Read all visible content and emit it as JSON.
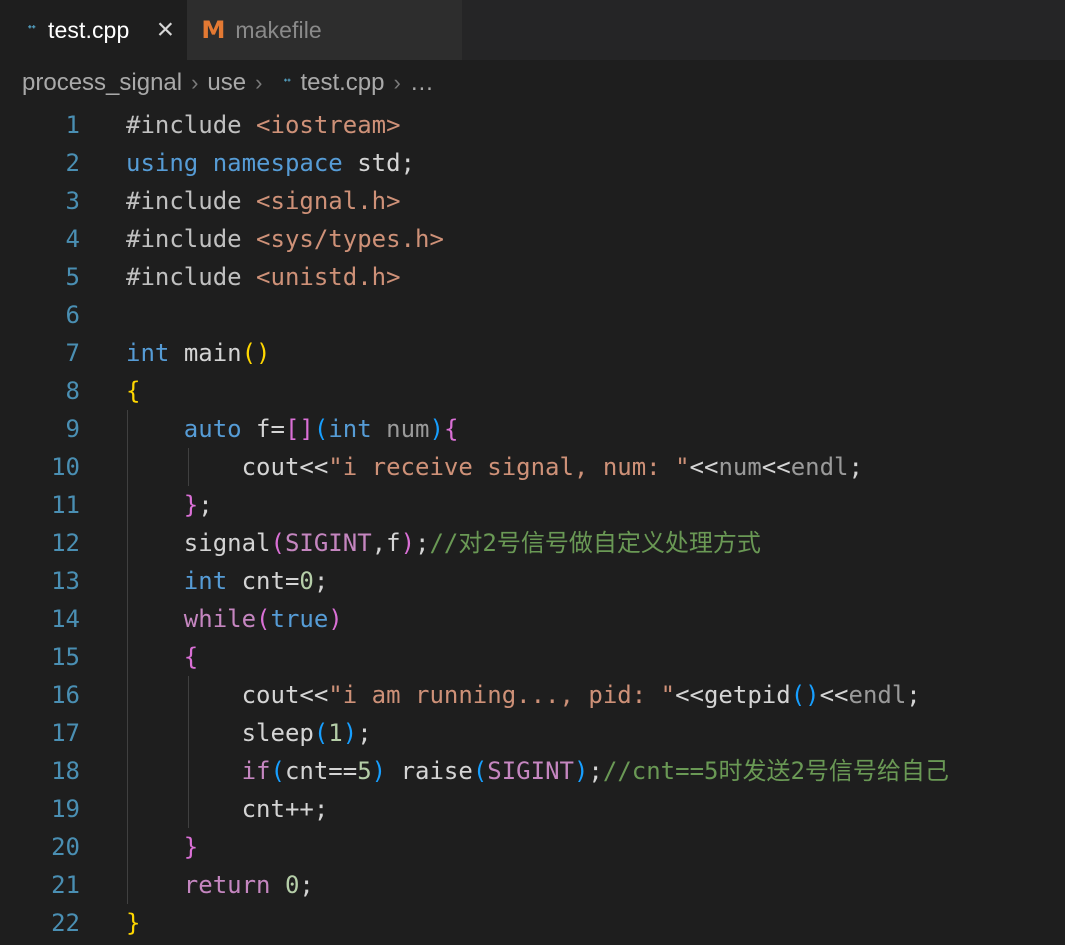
{
  "window": {
    "app": "Visual Studio Code",
    "theme": "Dark+"
  },
  "tabs": [
    {
      "label": "test.cpp",
      "icon": "cpp-file-icon",
      "active": true,
      "close_glyph": "×"
    },
    {
      "label": "makefile",
      "icon": "makefile-icon",
      "active": false,
      "close_glyph": ""
    }
  ],
  "breadcrumb": {
    "separator": "›",
    "items": [
      {
        "label": "process_signal",
        "icon": ""
      },
      {
        "label": "use",
        "icon": ""
      },
      {
        "label": "test.cpp",
        "icon": "cpp-file-icon"
      },
      {
        "label": "…",
        "icon": ""
      }
    ]
  },
  "editor": {
    "language": "C++",
    "first_line": 1,
    "last_line": 22,
    "lines": [
      {
        "n": "1",
        "indent": 0,
        "tokens": [
          {
            "t": "#include ",
            "c": "t-pre"
          },
          {
            "t": "<iostream>",
            "c": "t-inc"
          }
        ]
      },
      {
        "n": "2",
        "indent": 0,
        "tokens": [
          {
            "t": "using namespace",
            "c": "t-kw"
          },
          {
            "t": " std;",
            "c": "t-plain"
          }
        ]
      },
      {
        "n": "3",
        "indent": 0,
        "tokens": [
          {
            "t": "#include ",
            "c": "t-pre"
          },
          {
            "t": "<signal.h>",
            "c": "t-inc"
          }
        ]
      },
      {
        "n": "4",
        "indent": 0,
        "tokens": [
          {
            "t": "#include ",
            "c": "t-pre"
          },
          {
            "t": "<sys/types.h>",
            "c": "t-inc"
          }
        ]
      },
      {
        "n": "5",
        "indent": 0,
        "tokens": [
          {
            "t": "#include ",
            "c": "t-pre"
          },
          {
            "t": "<unistd.h>",
            "c": "t-inc"
          }
        ]
      },
      {
        "n": "6",
        "indent": 0,
        "tokens": []
      },
      {
        "n": "7",
        "indent": 0,
        "tokens": [
          {
            "t": "int",
            "c": "t-kw"
          },
          {
            "t": " ",
            "c": "t-plain"
          },
          {
            "t": "main",
            "c": "t-plain"
          },
          {
            "t": "()",
            "c": "t-b1"
          }
        ]
      },
      {
        "n": "8",
        "indent": 0,
        "tokens": [
          {
            "t": "{",
            "c": "t-b1"
          }
        ]
      },
      {
        "n": "9",
        "indent": 1,
        "tokens": [
          {
            "t": "    ",
            "c": "t-plain"
          },
          {
            "t": "auto",
            "c": "t-kw"
          },
          {
            "t": " f=",
            "c": "t-plain"
          },
          {
            "t": "[]",
            "c": "t-b2"
          },
          {
            "t": "(",
            "c": "t-b3"
          },
          {
            "t": "int",
            "c": "t-kw"
          },
          {
            "t": " ",
            "c": "t-plain"
          },
          {
            "t": "num",
            "c": "t-param"
          },
          {
            "t": ")",
            "c": "t-b3"
          },
          {
            "t": "{",
            "c": "t-b2"
          }
        ]
      },
      {
        "n": "10",
        "indent": 2,
        "tokens": [
          {
            "t": "        ",
            "c": "t-plain"
          },
          {
            "t": "cout<<",
            "c": "t-plain"
          },
          {
            "t": "\"i receive signal, num: \"",
            "c": "t-str"
          },
          {
            "t": "<<",
            "c": "t-plain"
          },
          {
            "t": "num",
            "c": "t-param"
          },
          {
            "t": "<<",
            "c": "t-plain"
          },
          {
            "t": "endl",
            "c": "t-param"
          },
          {
            "t": ";",
            "c": "t-plain"
          }
        ]
      },
      {
        "n": "11",
        "indent": 1,
        "tokens": [
          {
            "t": "    ",
            "c": "t-plain"
          },
          {
            "t": "}",
            "c": "t-b2"
          },
          {
            "t": ";",
            "c": "t-plain"
          }
        ]
      },
      {
        "n": "12",
        "indent": 1,
        "tokens": [
          {
            "t": "    ",
            "c": "t-plain"
          },
          {
            "t": "signal",
            "c": "t-plain"
          },
          {
            "t": "(",
            "c": "t-b2"
          },
          {
            "t": "SIGINT",
            "c": "t-const"
          },
          {
            "t": ",f",
            "c": "t-plain"
          },
          {
            "t": ")",
            "c": "t-b2"
          },
          {
            "t": ";",
            "c": "t-plain"
          },
          {
            "t": "//对2号信号做自定义处理方式",
            "c": "t-cmt"
          }
        ]
      },
      {
        "n": "13",
        "indent": 1,
        "tokens": [
          {
            "t": "    ",
            "c": "t-plain"
          },
          {
            "t": "int",
            "c": "t-kw"
          },
          {
            "t": " cnt=",
            "c": "t-plain"
          },
          {
            "t": "0",
            "c": "t-num"
          },
          {
            "t": ";",
            "c": "t-plain"
          }
        ]
      },
      {
        "n": "14",
        "indent": 1,
        "tokens": [
          {
            "t": "    ",
            "c": "t-plain"
          },
          {
            "t": "while",
            "c": "t-ctl"
          },
          {
            "t": "(",
            "c": "t-b2"
          },
          {
            "t": "true",
            "c": "t-kw"
          },
          {
            "t": ")",
            "c": "t-b2"
          }
        ]
      },
      {
        "n": "15",
        "indent": 1,
        "tokens": [
          {
            "t": "    ",
            "c": "t-plain"
          },
          {
            "t": "{",
            "c": "t-b2"
          }
        ]
      },
      {
        "n": "16",
        "indent": 2,
        "tokens": [
          {
            "t": "        ",
            "c": "t-plain"
          },
          {
            "t": "cout<<",
            "c": "t-plain"
          },
          {
            "t": "\"i am running..., pid: \"",
            "c": "t-str"
          },
          {
            "t": "<<",
            "c": "t-plain"
          },
          {
            "t": "getpid",
            "c": "t-plain"
          },
          {
            "t": "()",
            "c": "t-b3"
          },
          {
            "t": "<<",
            "c": "t-plain"
          },
          {
            "t": "endl",
            "c": "t-param"
          },
          {
            "t": ";",
            "c": "t-plain"
          }
        ]
      },
      {
        "n": "17",
        "indent": 2,
        "tokens": [
          {
            "t": "        ",
            "c": "t-plain"
          },
          {
            "t": "sleep",
            "c": "t-plain"
          },
          {
            "t": "(",
            "c": "t-b3"
          },
          {
            "t": "1",
            "c": "t-num"
          },
          {
            "t": ")",
            "c": "t-b3"
          },
          {
            "t": ";",
            "c": "t-plain"
          }
        ]
      },
      {
        "n": "18",
        "indent": 2,
        "tokens": [
          {
            "t": "        ",
            "c": "t-plain"
          },
          {
            "t": "if",
            "c": "t-ctl"
          },
          {
            "t": "(",
            "c": "t-b3"
          },
          {
            "t": "cnt==",
            "c": "t-plain"
          },
          {
            "t": "5",
            "c": "t-num"
          },
          {
            "t": ")",
            "c": "t-b3"
          },
          {
            "t": " ",
            "c": "t-plain"
          },
          {
            "t": "raise",
            "c": "t-plain"
          },
          {
            "t": "(",
            "c": "t-b3"
          },
          {
            "t": "SIGINT",
            "c": "t-const"
          },
          {
            "t": ")",
            "c": "t-b3"
          },
          {
            "t": ";",
            "c": "t-plain"
          },
          {
            "t": "//cnt==5时发送2号信号给自己",
            "c": "t-cmt"
          }
        ]
      },
      {
        "n": "19",
        "indent": 2,
        "tokens": [
          {
            "t": "        ",
            "c": "t-plain"
          },
          {
            "t": "cnt++;",
            "c": "t-plain"
          }
        ]
      },
      {
        "n": "20",
        "indent": 1,
        "tokens": [
          {
            "t": "    ",
            "c": "t-plain"
          },
          {
            "t": "}",
            "c": "t-b2"
          }
        ]
      },
      {
        "n": "21",
        "indent": 1,
        "tokens": [
          {
            "t": "    ",
            "c": "t-plain"
          },
          {
            "t": "return",
            "c": "t-ctl"
          },
          {
            "t": " ",
            "c": "t-plain"
          },
          {
            "t": "0",
            "c": "t-num"
          },
          {
            "t": ";",
            "c": "t-plain"
          }
        ]
      },
      {
        "n": "22",
        "indent": 0,
        "tokens": [
          {
            "t": "}",
            "c": "t-b1"
          }
        ]
      }
    ]
  },
  "colors": {
    "editor_background": "#1e1e1e",
    "tabbar_background": "#252526",
    "inactive_tab_background": "#2d2d2d",
    "line_number": "#4a8fb3",
    "string": "#ce9178",
    "comment": "#6a9955",
    "keyword": "#569cd6",
    "control_keyword": "#c586c0",
    "number": "#b5cea8",
    "bracket_level_1": "#ffd700",
    "bracket_level_2": "#da70d6",
    "bracket_level_3": "#179fff",
    "cpp_icon": "#519aba",
    "makefile_icon": "#e37933"
  }
}
